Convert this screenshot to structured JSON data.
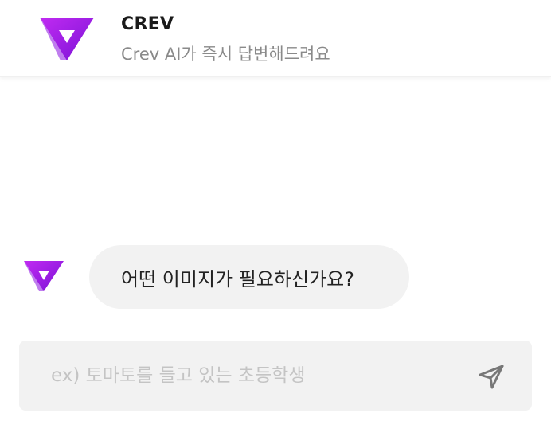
{
  "header": {
    "title": "CREV",
    "subtitle": "Crev AI가 즉시 답변해드려요",
    "logo_icon": "crev-logo-icon"
  },
  "chat": {
    "messages": [
      {
        "sender": "bot",
        "avatar_icon": "crev-logo-icon",
        "text": "어떤 이미지가 필요하신가요?"
      }
    ]
  },
  "composer": {
    "placeholder": "ex) 토마토를 들고 있는 초등학생",
    "value": "",
    "send_icon": "send-icon"
  },
  "colors": {
    "brand_purple_light": "#B71CF0",
    "brand_purple_dark": "#6A0FD8",
    "bubble_bg": "#F2F2F2",
    "input_bg": "#F2F2F2",
    "subtitle_text": "#8A8A8A",
    "send_icon": "#777777"
  }
}
